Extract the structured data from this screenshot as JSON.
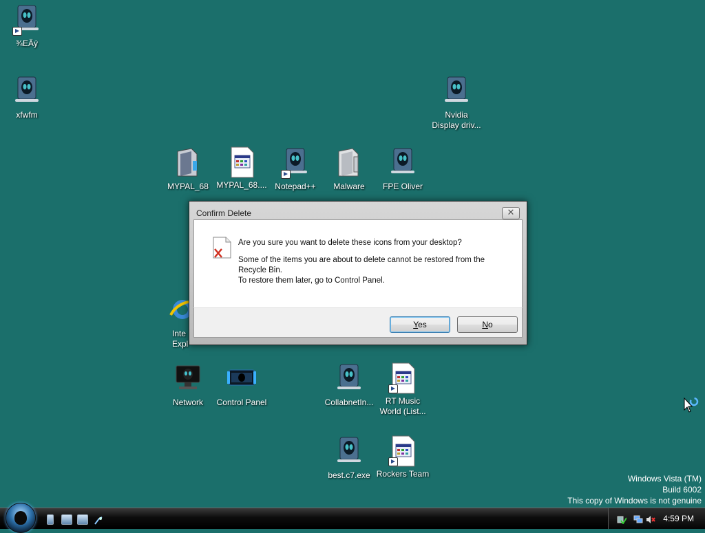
{
  "desktop": {
    "icons": [
      {
        "label": "¾EÄý"
      },
      {
        "label": "xfwfm"
      },
      {
        "label": "Nvidia\nDisplay driv..."
      },
      {
        "label": "MYPAL_68"
      },
      {
        "label": "MYPAL_68...."
      },
      {
        "label": "Notepad++"
      },
      {
        "label": "Malware"
      },
      {
        "label": "FPE Oliver"
      },
      {
        "label": "Inte\nExpl"
      },
      {
        "label": "Network"
      },
      {
        "label": "Control Panel"
      },
      {
        "label": "CollabnetIn..."
      },
      {
        "label": "RT Music\nWorld (List..."
      },
      {
        "label": "best.c7.exe"
      },
      {
        "label": "Rockers Team"
      }
    ]
  },
  "dialog": {
    "title": "Confirm Delete",
    "close_glyph": "✕",
    "question": "Are you sure you want to delete these icons from your desktop?",
    "note_line1": "Some of the items you are about to delete cannot be restored from the",
    "note_line2": "Recycle Bin.",
    "note_line3": "To restore them later, go to Control Panel.",
    "yes_accel": "Y",
    "yes_rest": "es",
    "no_accel": "N",
    "no_rest": "o",
    "icon": "file-delete-icon"
  },
  "watermark": {
    "line1": "Windows Vista (TM)",
    "line2": "Build 6002",
    "line3": "This copy of Windows is not genuine"
  },
  "taskbar": {
    "clock": "4:59 PM"
  },
  "colors": {
    "desktop": "#1b6f6b",
    "dialog_default_border": "#3c7fb1"
  }
}
